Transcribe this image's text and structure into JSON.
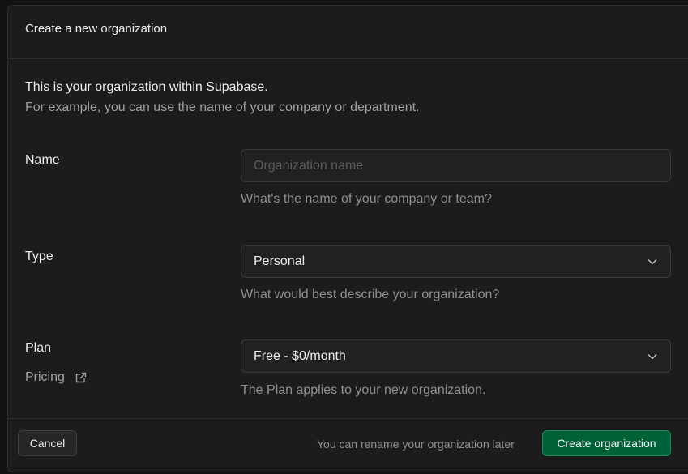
{
  "dialog": {
    "title": "Create a new organization"
  },
  "intro": {
    "line1": "This is your organization within Supabase.",
    "line2": "For example, you can use the name of your company or department."
  },
  "fields": {
    "name": {
      "label": "Name",
      "value": "",
      "placeholder": "Organization name",
      "help": "What's the name of your company or team?"
    },
    "type": {
      "label": "Type",
      "selected": "Personal",
      "help": "What would best describe your organization?"
    },
    "plan": {
      "label": "Plan",
      "pricing_link": "Pricing",
      "selected": "Free - $0/month",
      "help": "The Plan applies to your new organization."
    }
  },
  "footer": {
    "cancel_label": "Cancel",
    "note": "You can rename your organization later",
    "create_label": "Create organization"
  },
  "icons": {
    "pricing": "external-link-icon",
    "type_select": "chevron-down-icon",
    "plan_select": "chevron-down-icon"
  },
  "colors": {
    "background": "#1c1c1c",
    "border": "#2e2e2e",
    "primary_button": "#006239",
    "text": "#ededed",
    "muted_text": "#8f8f8f"
  }
}
